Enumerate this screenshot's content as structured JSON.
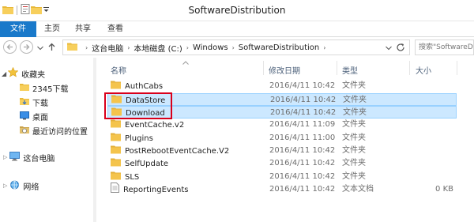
{
  "window": {
    "title": "SoftwareDistribution"
  },
  "ribbon": {
    "tabs": [
      "文件",
      "主页",
      "共享",
      "查看"
    ]
  },
  "address": {
    "crumbs": [
      "这台电脑",
      "本地磁盘 (C:)",
      "Windows",
      "SoftwareDistribution"
    ],
    "search_placeholder": "搜索\"SoftwareDistribution\""
  },
  "nav": {
    "items": [
      {
        "label": "收藏夹",
        "icon": "star-icon"
      },
      {
        "label": "2345下载",
        "icon": "folder-icon"
      },
      {
        "label": "下载",
        "icon": "download-folder-icon"
      },
      {
        "label": "桌面",
        "icon": "desktop-icon"
      },
      {
        "label": "最近访问的位置",
        "icon": "recent-places-icon"
      },
      {
        "label": "这台电脑",
        "icon": "computer-icon"
      },
      {
        "label": "网络",
        "icon": "network-icon"
      }
    ]
  },
  "columns": {
    "name": "名称",
    "date": "修改日期",
    "type": "类型",
    "size": "大小"
  },
  "files": [
    {
      "name": "AuthCabs",
      "date": "2016/4/11 10:42",
      "type": "文件夹",
      "size": "",
      "icon": "folder-icon",
      "selected": false
    },
    {
      "name": "DataStore",
      "date": "2016/4/11 10:42",
      "type": "文件夹",
      "size": "",
      "icon": "folder-icon",
      "selected": true
    },
    {
      "name": "Download",
      "date": "2016/4/11 10:42",
      "type": "文件夹",
      "size": "",
      "icon": "folder-icon",
      "selected": true
    },
    {
      "name": "EventCache.v2",
      "date": "2016/4/11 11:09",
      "type": "文件夹",
      "size": "",
      "icon": "folder-icon",
      "selected": false
    },
    {
      "name": "Plugins",
      "date": "2016/4/11 11:00",
      "type": "文件夹",
      "size": "",
      "icon": "folder-icon",
      "selected": false
    },
    {
      "name": "PostRebootEventCache.V2",
      "date": "2016/4/11 10:42",
      "type": "文件夹",
      "size": "",
      "icon": "folder-icon",
      "selected": false
    },
    {
      "name": "SelfUpdate",
      "date": "2016/4/11 10:42",
      "type": "文件夹",
      "size": "",
      "icon": "folder-icon",
      "selected": false
    },
    {
      "name": "SLS",
      "date": "2016/4/11 10:42",
      "type": "文件夹",
      "size": "",
      "icon": "folder-icon",
      "selected": false
    },
    {
      "name": "ReportingEvents",
      "date": "2016/4/11 10:42",
      "type": "文本文档",
      "size": "0 KB",
      "icon": "text-file-icon",
      "selected": false
    }
  ],
  "colors": {
    "accent": "#1979ca",
    "selection_bg": "#cce8ff",
    "selection_border": "#99d1ff",
    "highlight_box": "#d9001b",
    "folder": "#f4c44c"
  }
}
